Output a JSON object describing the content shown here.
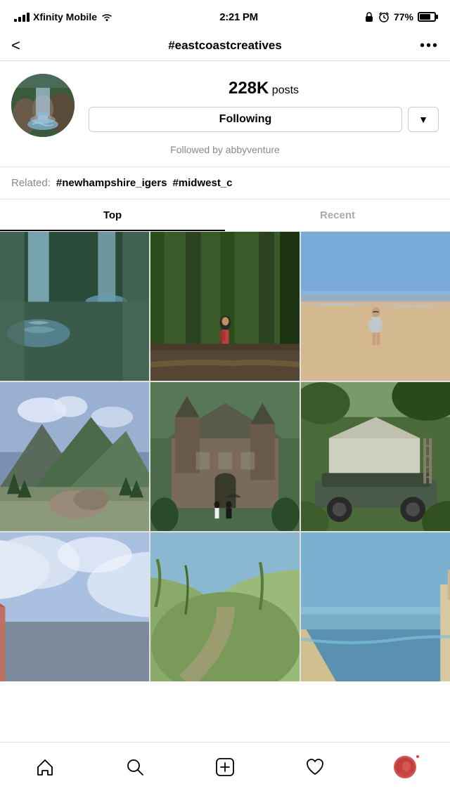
{
  "statusBar": {
    "carrier": "Xfinity Mobile",
    "time": "2:21 PM",
    "battery": "77%"
  },
  "header": {
    "title": "#eastcoastcreatives",
    "backLabel": "<",
    "moreLabel": "•••"
  },
  "profile": {
    "postsCount": "228K",
    "postsLabel": " posts",
    "followingLabel": "Following",
    "dropdownArrow": "▼",
    "followedBy": "Followed by abbyventure"
  },
  "related": {
    "label": "Related:",
    "tags": [
      "#newhampshire_igers",
      "#midwest_c"
    ]
  },
  "tabs": [
    {
      "label": "Top",
      "active": true
    },
    {
      "label": "Recent",
      "active": false
    }
  ],
  "nav": {
    "home": "home",
    "search": "search",
    "add": "add",
    "heart": "heart",
    "profile": "profile"
  }
}
